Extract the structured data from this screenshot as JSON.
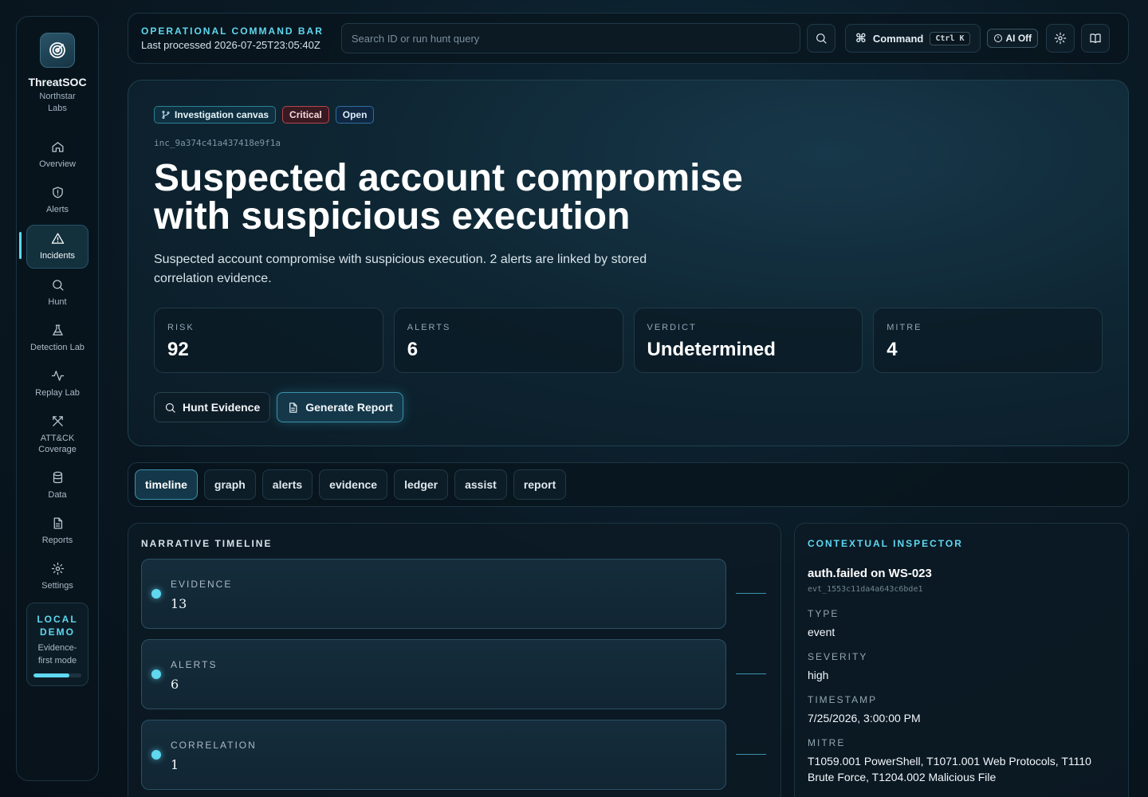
{
  "sidebar": {
    "brand_name": "ThreatSOC",
    "brand_org": "Northstar Labs",
    "nav": [
      {
        "label": "Overview"
      },
      {
        "label": "Alerts"
      },
      {
        "label": "Incidents"
      },
      {
        "label": "Hunt"
      },
      {
        "label": "Detection Lab"
      },
      {
        "label": "Replay Lab"
      },
      {
        "label": "ATT&CK Coverage"
      },
      {
        "label": "Data"
      },
      {
        "label": "Reports"
      },
      {
        "label": "Settings"
      }
    ],
    "active": "Incidents",
    "demo_title": "LOCAL DEMO",
    "demo_sub": "Evidence-first mode",
    "demo_progress": 0.75
  },
  "topbar": {
    "title": "OPERATIONAL COMMAND BAR",
    "subtitle": "Last processed 2026-07-25T23:05:40Z",
    "search_placeholder": "Search ID or run hunt query",
    "command_label": "Command",
    "command_kbd": "Ctrl K",
    "ai_label": "AI Off"
  },
  "incident": {
    "badges": {
      "canvas": "Investigation canvas",
      "severity": "Critical",
      "status": "Open"
    },
    "id": "inc_9a374c41a437418e9f1a",
    "title": "Suspected account compromise with suspicious execution",
    "description": "Suspected account compromise with suspicious execution. 2 alerts are linked by stored correlation evidence.",
    "metrics": [
      {
        "label": "RISK",
        "value": "92"
      },
      {
        "label": "ALERTS",
        "value": "6"
      },
      {
        "label": "VERDICT",
        "value": "Undetermined"
      },
      {
        "label": "MITRE",
        "value": "4"
      }
    ],
    "actions": {
      "hunt": "Hunt Evidence",
      "report": "Generate Report"
    }
  },
  "tabs": [
    "timeline",
    "graph",
    "alerts",
    "evidence",
    "ledger",
    "assist",
    "report"
  ],
  "active_tab": "timeline",
  "timeline": {
    "title": "NARRATIVE TIMELINE",
    "items": [
      {
        "label": "EVIDENCE",
        "value": "13"
      },
      {
        "label": "ALERTS",
        "value": "6"
      },
      {
        "label": "CORRELATION",
        "value": "1"
      }
    ]
  },
  "inspector": {
    "title": "CONTEXTUAL INSPECTOR",
    "event_title": "auth.failed on WS-023",
    "event_id": "evt_1553c11da4a643c6bde1",
    "fields": [
      {
        "label": "TYPE",
        "value": "event"
      },
      {
        "label": "SEVERITY",
        "value": "high"
      },
      {
        "label": "TIMESTAMP",
        "value": "7/25/2026, 3:00:00 PM"
      },
      {
        "label": "MITRE",
        "value": "T1059.001 PowerShell, T1071.001 Web Protocols, T1110 Brute Force, T1204.002 Malicious File"
      }
    ]
  },
  "colors": {
    "accent": "#5fd8f0",
    "critical": "#b5454e",
    "open": "#2f6ea2"
  }
}
